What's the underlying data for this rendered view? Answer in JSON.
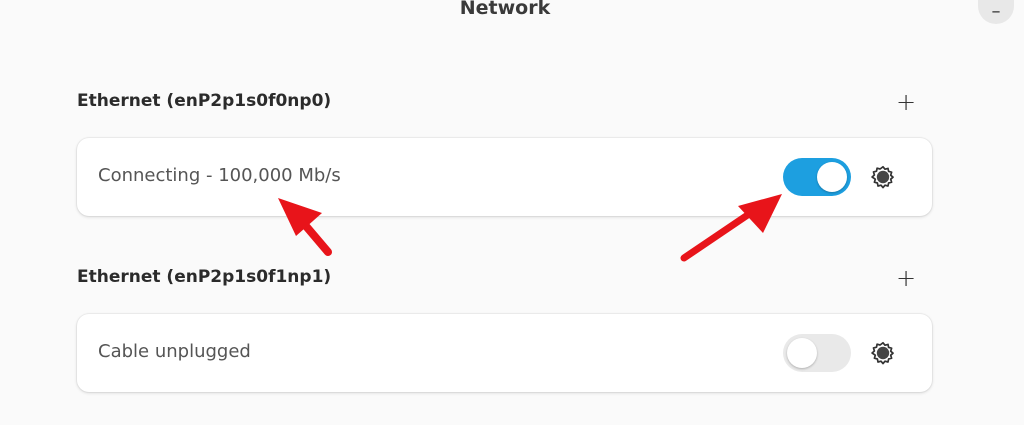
{
  "window": {
    "title": "Network",
    "minimize_label": "–"
  },
  "sections": [
    {
      "heading": "Ethernet (enP2p1s0f0np0)",
      "add_label": "+",
      "status": "Connecting - 100,000 Mb/s",
      "toggle_on": true
    },
    {
      "heading": "Ethernet (enP2p1s0f1np1)",
      "add_label": "+",
      "status": "Cable unplugged",
      "toggle_on": false
    }
  ],
  "icons": {
    "settings": "gear-icon",
    "add": "plus-icon",
    "annotation": "red-arrow"
  },
  "colors": {
    "toggle_on": "#1d9fe0",
    "toggle_off": "#e9e9e9",
    "annotation": "#e8141a",
    "background": "#fafafa"
  }
}
